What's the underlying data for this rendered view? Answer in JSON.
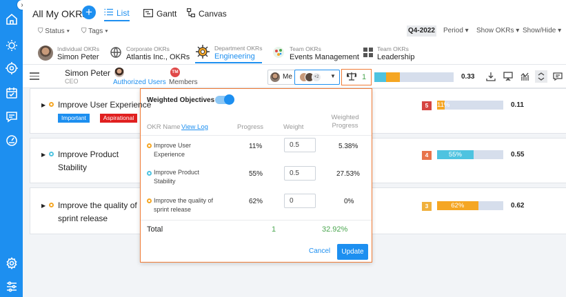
{
  "header": {
    "page_title": "All My OKRs",
    "views": [
      {
        "label": "List"
      },
      {
        "label": "Gantt"
      },
      {
        "label": "Canvas"
      }
    ],
    "filters": [
      {
        "label": "Status"
      },
      {
        "label": "Tags"
      }
    ],
    "quarter": "Q4-2022",
    "right_filters": [
      {
        "label": "Period"
      },
      {
        "label": "Show OKRs"
      },
      {
        "label": "Show/Hide"
      }
    ]
  },
  "levels": [
    {
      "sub": "Individual OKRs",
      "main": "Simon Peter"
    },
    {
      "sub": "Corporate OKRs",
      "main": "Atlantis Inc., OKRs"
    },
    {
      "sub": "Department OKRs",
      "main": "Engineering"
    },
    {
      "sub": "Team OKRs",
      "main": "Events Management"
    },
    {
      "sub": "Team OKRs",
      "main": "Leadership"
    }
  ],
  "owner": {
    "name": "Simon Peter",
    "title": "CEO",
    "authorized_label": "Authorized Users",
    "members_label": "Members",
    "members_initials": "TM",
    "me_label": "Me",
    "more_count": "+2",
    "weight_count": "1",
    "overall_value": "0.33",
    "overall_segments": [
      {
        "fraction": 0.15,
        "color": "#4ec3e0"
      },
      {
        "fraction": 0.17,
        "color": "#f5a623"
      }
    ]
  },
  "objectives": [
    {
      "title": "Improve User Experience",
      "dot_color": "#f5a623",
      "tags": [
        {
          "label": "Important",
          "color": "#1d8ff0"
        },
        {
          "label": "Aspirational",
          "color": "#e02020"
        }
      ],
      "count": "5",
      "count_color": "#d64541",
      "progress_label": "11%",
      "progress": 0.11,
      "bar_color": "#f5a623",
      "value": "0.11"
    },
    {
      "title": "Improve Product Stability",
      "dot_color": "#4ec3e0",
      "tags": [],
      "count": "4",
      "count_color": "#e8734a",
      "progress_label": "55%",
      "progress": 0.55,
      "bar_color": "#4ec3e0",
      "value": "0.55"
    },
    {
      "title": "Improve the quality of sprint release",
      "dot_color": "#f5a623",
      "tags": [],
      "count": "3",
      "count_color": "#f0b03c",
      "progress_label": "62%",
      "progress": 0.62,
      "bar_color": "#f5a623",
      "value": "0.62"
    }
  ],
  "popup": {
    "title": "Weighted Objectives",
    "col_name": "OKR Name",
    "view_log": "View Log",
    "col_progress": "Progress",
    "col_weight": "Weight",
    "col_weighted": "Weighted Progress",
    "rows": [
      {
        "name": "Improve User Experience",
        "dot_color": "#f5a623",
        "progress": "11%",
        "weight": "0.5",
        "weighted": "5.38%"
      },
      {
        "name": "Improve Product Stability",
        "dot_color": "#4ec3e0",
        "progress": "55%",
        "weight": "0.5",
        "weighted": "27.53%"
      },
      {
        "name": "Improve the quality of sprint release",
        "dot_color": "#f5a623",
        "progress": "62%",
        "weight": "0",
        "weighted": "0%"
      }
    ],
    "total_label": "Total",
    "total_weight": "1",
    "total_weighted": "32.92%",
    "cancel": "Cancel",
    "update": "Update"
  }
}
